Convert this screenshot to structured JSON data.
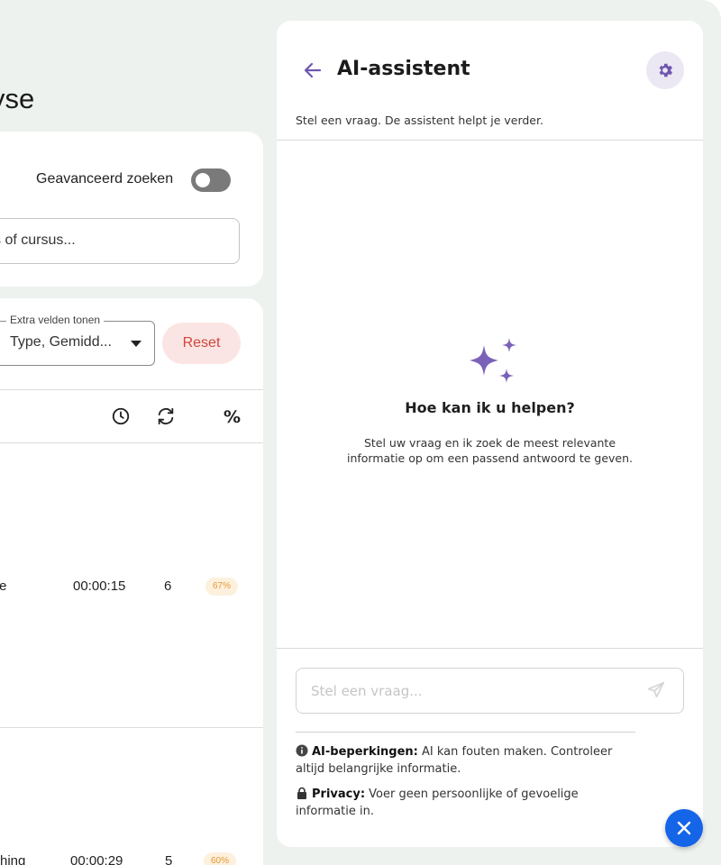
{
  "background": {
    "page_title_fragment": "yse",
    "search_card": {
      "advanced_search_label": "Geavanceerd zoeken",
      "advanced_search_enabled": false,
      "search_value_fragment": "s of cursus..."
    },
    "table_card": {
      "extra_fields_label": "Extra velden tonen",
      "extra_fields_value": "Type, Gemidd...",
      "reset_label": "Reset",
      "header_icons": [
        "clock-icon",
        "refresh-icon"
      ],
      "percent_header": "%",
      "rows": [
        {
          "name_fragment": "oice",
          "duration": "00:00:15",
          "attempts": "6",
          "percent": "67%"
        },
        {
          "name_fragment": "atching",
          "duration": "00:00:29",
          "attempts": "5",
          "percent": "60%"
        }
      ]
    }
  },
  "assistant": {
    "title": "AI-assistent",
    "subtitle": "Stel een vraag. De assistent helpt je verder.",
    "empty_state": {
      "icon": "sparkles-icon",
      "title": "Hoe kan ik u helpen?",
      "body": "Stel uw vraag en ik zoek de meest relevante informatie op om een passend antwoord te geven."
    },
    "input_placeholder": "Stel een vraag...",
    "notes": {
      "limitations_title": "AI-beperkingen:",
      "limitations_text": " AI kan fouten maken. Controleer altijd belangrijke informatie.",
      "privacy_title": "Privacy:",
      "privacy_text": " Voer geen persoonlijke of gevoelige informatie in."
    }
  },
  "colors": {
    "accent_purple": "#6f56b0",
    "fab_blue": "#1565e8",
    "reset_red": "#d0453c",
    "badge_orange": "#e59a3a",
    "app_background": "#edf2ee"
  }
}
